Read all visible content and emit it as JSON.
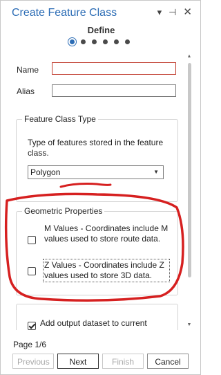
{
  "window": {
    "title": "Create Feature Class",
    "controls": {
      "menu": "▾",
      "pin": "⊣",
      "close": "✕"
    }
  },
  "step": {
    "title": "Define",
    "total_dots": 6,
    "active_index": 0
  },
  "fields": {
    "name_label": "Name",
    "name_value": "",
    "alias_label": "Alias",
    "alias_value": ""
  },
  "feature_class_type": {
    "legend": "Feature Class Type",
    "description": "Type of features stored in the feature class.",
    "selected": "Polygon"
  },
  "geometric_properties": {
    "legend": "Geometric Properties",
    "m_values": {
      "label": "M Values - Coordinates include M values used to store route data.",
      "checked": false
    },
    "z_values": {
      "label": "Z Values - Coordinates include Z values used to store 3D data.",
      "checked": false
    }
  },
  "output": {
    "label": "Add output dataset to current",
    "checked": true
  },
  "footer": {
    "page_indicator": "Page 1/6",
    "buttons": {
      "previous": "Previous",
      "next": "Next",
      "finish": "Finish",
      "cancel": "Cancel"
    }
  },
  "colors": {
    "title": "#2b6cb5",
    "accent": "#2b6cb5",
    "annotation": "#d62020",
    "error_border": "#c0392b"
  }
}
